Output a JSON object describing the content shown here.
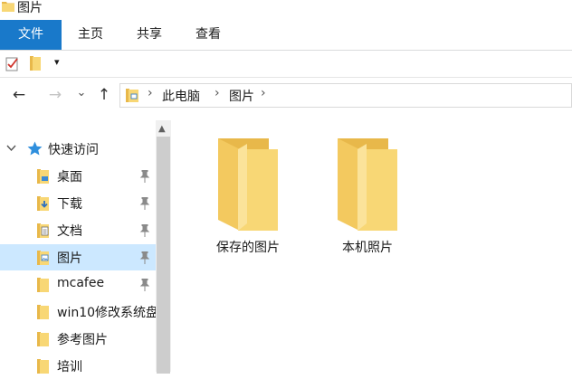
{
  "window": {
    "title": "图片"
  },
  "ribbon": {
    "tabs": [
      {
        "label": "文件",
        "active": true
      },
      {
        "label": "主页"
      },
      {
        "label": "共享"
      },
      {
        "label": "查看"
      }
    ]
  },
  "quick_access": {
    "dropdown_glyph": "▾"
  },
  "navigation": {
    "back_glyph": "←",
    "forward_glyph": "→",
    "recent_glyph": "⌄",
    "up_glyph": "↑"
  },
  "address_bar": {
    "breadcrumbs": [
      "此电脑",
      "图片"
    ],
    "separator": "›"
  },
  "nav_pane": {
    "root": {
      "label": "快速访问",
      "icon": "star-icon"
    },
    "items": [
      {
        "label": "桌面",
        "icon": "desktop-folder-icon",
        "pinned": true
      },
      {
        "label": "下载",
        "icon": "download-folder-icon",
        "pinned": true
      },
      {
        "label": "文档",
        "icon": "documents-folder-icon",
        "pinned": true
      },
      {
        "label": "图片",
        "icon": "pictures-folder-icon",
        "pinned": true,
        "selected": true
      },
      {
        "label": "mcafee",
        "icon": "folder-icon",
        "pinned": true
      },
      {
        "label": "win10修改系统盘",
        "icon": "folder-icon",
        "pinned": false
      },
      {
        "label": "参考图片",
        "icon": "folder-icon",
        "pinned": false
      },
      {
        "label": "培训",
        "icon": "folder-icon",
        "pinned": false
      }
    ]
  },
  "content": {
    "items": [
      {
        "label": "保存的图片",
        "icon": "folder-icon"
      },
      {
        "label": "本机照片",
        "icon": "folder-icon"
      }
    ]
  },
  "colors": {
    "accent": "#1979ca",
    "selection": "#cce8ff",
    "folder_front": "#f8d775",
    "folder_back": "#e8b84a"
  }
}
